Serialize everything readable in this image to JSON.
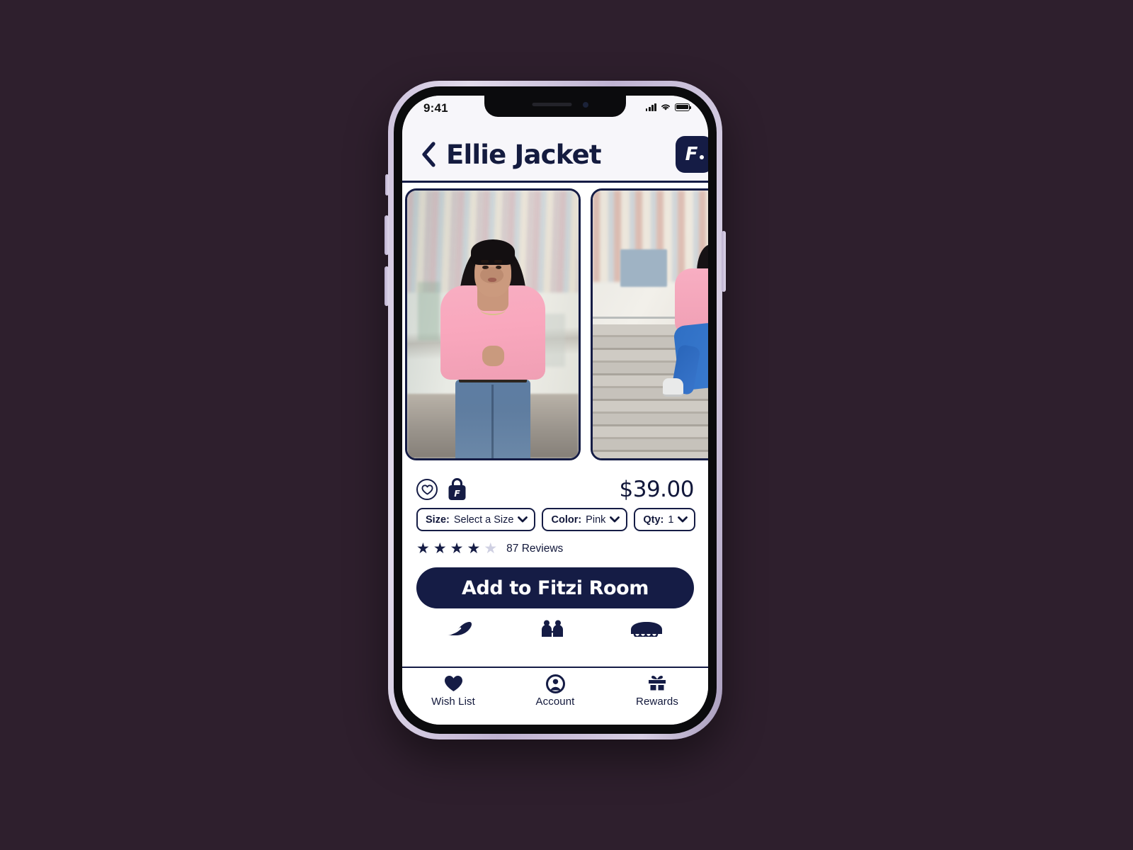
{
  "theme": {
    "page_background": "#2e1f2d",
    "brand_navy": "#151c45",
    "screen_background": "#ffffff",
    "phone_frame": "#cdc2dd",
    "star_filled": "#151c45",
    "star_empty": "#cfd0e2"
  },
  "status_bar": {
    "time": "9:41",
    "signal_icon": "cellular-bars-icon",
    "wifi_icon": "wifi-icon",
    "battery_icon": "battery-icon"
  },
  "header": {
    "back_icon": "chevron-left-icon",
    "title": "Ellie Jacket",
    "logo_letter": "F",
    "logo_name": "fitzi-logo"
  },
  "gallery": {
    "images": [
      {
        "name": "product-photo-front",
        "alt": "Model wearing pink Ellie Jacket standing"
      },
      {
        "name": "product-photo-seated",
        "alt": "Model wearing pink Ellie Jacket seated on steps"
      }
    ]
  },
  "product": {
    "price": "$39.00",
    "wishlist_icon": "heart-outline-icon",
    "bag_icon": "shopping-bag-icon",
    "selectors": [
      {
        "name": "size-selector",
        "label": "Size:",
        "value": "Select a Size",
        "chevron": "chevron-down-icon"
      },
      {
        "name": "color-selector",
        "label": "Color:",
        "value": "Pink",
        "chevron": "chevron-down-icon"
      },
      {
        "name": "qty-selector",
        "label": "Qty:",
        "value": "1",
        "chevron": "chevron-down-icon"
      }
    ],
    "rating": {
      "filled_stars": 4,
      "total_stars": 5,
      "star_glyph": "★",
      "reviews_text": "87 Reviews"
    },
    "cta_label": "Add to Fitzi Room"
  },
  "secondary_icons": [
    {
      "name": "shoe-icon"
    },
    {
      "name": "two-people-icon"
    },
    {
      "name": "storefront-icon"
    }
  ],
  "tab_bar": {
    "items": [
      {
        "name": "tab-wish-list",
        "label": "Wish List",
        "icon": "heart-filled-icon"
      },
      {
        "name": "tab-account",
        "label": "Account",
        "icon": "user-circle-icon"
      },
      {
        "name": "tab-rewards",
        "label": "Rewards",
        "icon": "gift-icon"
      }
    ]
  }
}
